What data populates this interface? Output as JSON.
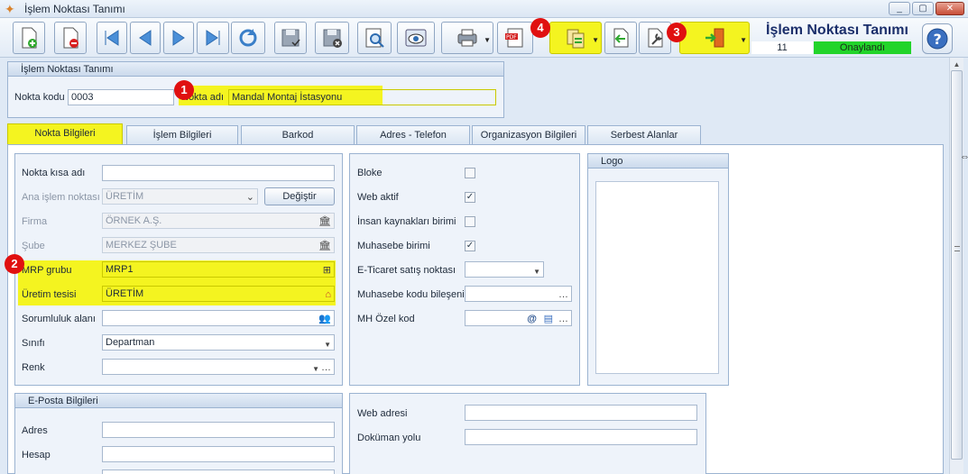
{
  "window": {
    "title": "İşlem Noktası Tanımı",
    "buttons": [
      "_",
      "▢",
      "✕"
    ]
  },
  "header": {
    "title": "İşlem Noktası Tanımı",
    "number": "11",
    "status": "Onaylandı",
    "status_color": "#22d42a"
  },
  "toolbar": {
    "icons": [
      "new-document-icon",
      "delete-document-icon",
      "first-record-icon",
      "previous-record-icon",
      "next-record-icon",
      "last-record-icon",
      "refresh-icon",
      "save-icon",
      "save-close-icon",
      "preview-icon",
      "view-icon",
      "print-icon",
      "pdf-icon",
      "export-list-icon",
      "back-arrow-icon",
      "tools-icon",
      "exit-door-icon",
      "help-icon"
    ],
    "highlight_color": "#f4f420"
  },
  "badges": [
    "1",
    "2",
    "3",
    "4"
  ],
  "top_group": {
    "header": "İşlem Noktası Tanımı",
    "code_label": "Nokta kodu",
    "code_value": "0003",
    "name_label": "Nokta adı",
    "name_value": "Mandal Montaj İstasyonu"
  },
  "tabs": [
    "Nokta Bilgileri",
    "İşlem Bilgileri",
    "Barkod",
    "Adres - Telefon",
    "Organizasyon Bilgileri",
    "Serbest Alanlar"
  ],
  "left_panel": {
    "short_name_label": "Nokta kısa adı",
    "short_name_value": "",
    "main_point_label": "Ana işlem noktası",
    "main_point_value": "ÜRETİM",
    "change_button": "Değiştir",
    "company_label": "Firma",
    "company_value": "ÖRNEK A.Ş.",
    "branch_label": "Şube",
    "branch_value": "MERKEZ ŞUBE",
    "mrp_label": "MRP grubu",
    "mrp_value": "MRP1",
    "facility_label": "Üretim tesisi",
    "facility_value": "ÜRETİM",
    "responsibility_label": "Sorumluluk alanı",
    "responsibility_value": "",
    "class_label": "Sınıfı",
    "class_value": "Departman",
    "color_label": "Renk",
    "color_value": ""
  },
  "middle_panel": {
    "block_label": "Bloke",
    "block_checked": false,
    "web_active_label": "Web aktif",
    "web_active_checked": true,
    "hr_unit_label": "İnsan kaynakları birimi",
    "hr_unit_checked": false,
    "accounting_unit_label": "Muhasebe birimi",
    "accounting_unit_checked": true,
    "ecommerce_label": "E-Ticaret satış noktası",
    "ecommerce_value": "",
    "accounting_code_label": "Muhasebe kodu bileşeni",
    "accounting_code_value": "",
    "mh_code_label": "MH Özel kod",
    "mh_code_value": ""
  },
  "logo_panel": {
    "header": "Logo"
  },
  "email_group": {
    "header": "E-Posta Bilgileri",
    "address_label": "Adres",
    "address_value": "",
    "account_label": "Hesap",
    "account_value": ""
  },
  "web_panel": {
    "web_address_label": "Web adresi",
    "web_address_value": "",
    "doc_path_label": "Doküman yolu",
    "doc_path_value": ""
  }
}
